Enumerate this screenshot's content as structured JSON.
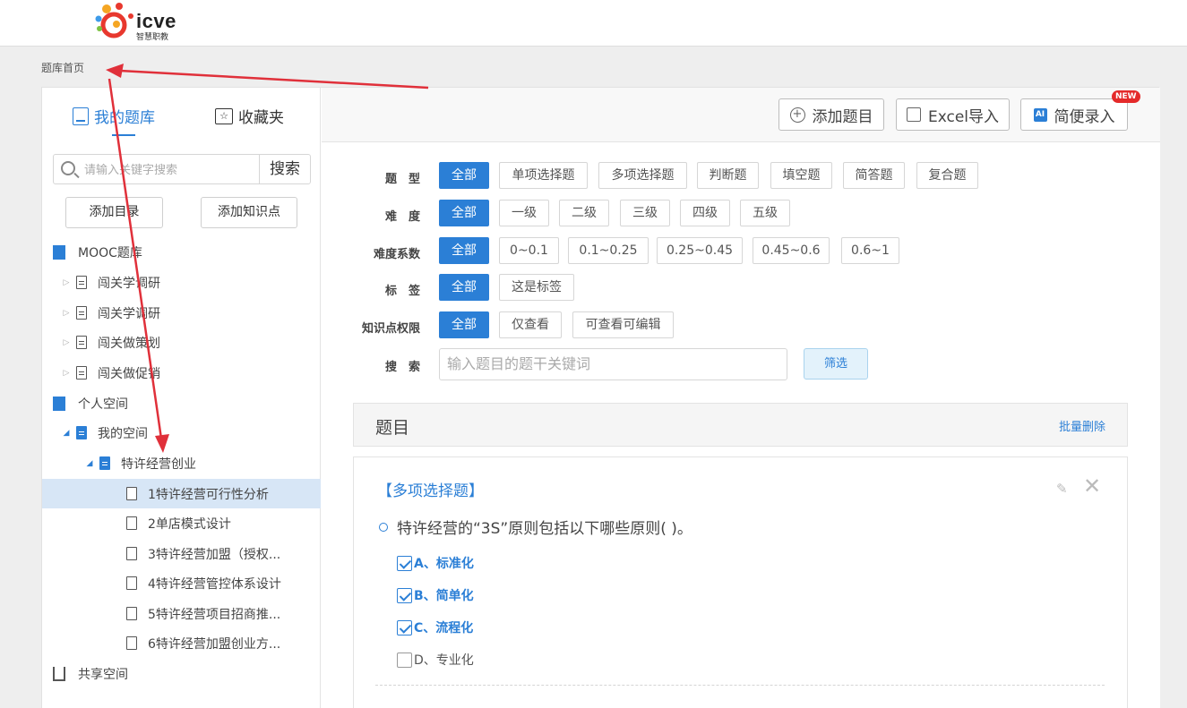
{
  "header": {
    "logo_text": "icve",
    "logo_subtitle": "智慧职教"
  },
  "breadcrumb": "题库首页",
  "sidebar": {
    "tabs": [
      {
        "label": "我的题库",
        "icon": "book-icon",
        "active": true
      },
      {
        "label": "收藏夹",
        "icon": "star-icon",
        "active": false
      }
    ],
    "search": {
      "placeholder": "请输入关键字搜索",
      "button": "搜索"
    },
    "buttons": {
      "add_dir": "添加目录",
      "add_kp": "添加知识点"
    },
    "tree": [
      {
        "label": "MOOC题库",
        "icon": "library-icon",
        "level": 0
      },
      {
        "label": "闯关学调研",
        "icon": "file-icon",
        "level": 1
      },
      {
        "label": "闯关学调研",
        "icon": "file-icon",
        "level": 1
      },
      {
        "label": "闯关做策划",
        "icon": "file-icon",
        "level": 1
      },
      {
        "label": "闯关做促销",
        "icon": "file-icon",
        "level": 1
      },
      {
        "label": "个人空间",
        "icon": "library-icon",
        "level": 0
      },
      {
        "label": "我的空间",
        "icon": "file-icon",
        "level": 1,
        "expanded": true
      },
      {
        "label": "特许经营创业",
        "icon": "file-icon",
        "level": 2,
        "expanded": true
      },
      {
        "label": "1特许经营可行性分析",
        "icon": "document-icon",
        "level": 3,
        "selected": true
      },
      {
        "label": "2单店模式设计",
        "icon": "document-icon",
        "level": 3
      },
      {
        "label": "3特许经营加盟（授权...",
        "icon": "document-icon",
        "level": 3
      },
      {
        "label": "4特许经营管控体系设计",
        "icon": "document-icon",
        "level": 3
      },
      {
        "label": "5特许经营项目招商推...",
        "icon": "document-icon",
        "level": 3
      },
      {
        "label": "6特许经营加盟创业方...",
        "icon": "document-icon",
        "level": 3
      },
      {
        "label": "共享空间",
        "icon": "library-outline-icon",
        "level": 0
      }
    ]
  },
  "toolbar": {
    "add_question": "添加题目",
    "excel_import": "Excel导入",
    "quick_entry": "简便录入",
    "new_badge": "NEW"
  },
  "filters": {
    "type": {
      "label": "题　型",
      "options": [
        "全部",
        "单项选择题",
        "多项选择题",
        "判断题",
        "填空题",
        "简答题",
        "复合题"
      ],
      "selected": "全部"
    },
    "difficulty": {
      "label": "难　度",
      "options": [
        "全部",
        "一级",
        "二级",
        "三级",
        "四级",
        "五级"
      ],
      "selected": "全部"
    },
    "coefficient": {
      "label": "难度系数",
      "options": [
        "全部",
        "0~0.1",
        "0.1~0.25",
        "0.25~0.45",
        "0.45~0.6",
        "0.6~1"
      ],
      "selected": "全部"
    },
    "tag": {
      "label": "标　签",
      "options": [
        "全部",
        "这是标签"
      ],
      "selected": "全部"
    },
    "permission": {
      "label": "知识点权限",
      "options": [
        "全部",
        "仅查看",
        "可查看可编辑"
      ],
      "selected": "全部"
    },
    "search": {
      "label": "搜　索",
      "placeholder": "输入题目的题干关键词",
      "button": "筛选"
    }
  },
  "question_list": {
    "title": "题目",
    "bulk_delete": "批量删除",
    "question": {
      "type": "【多项选择题】",
      "stem": "特许经营的“3S”原则包括以下哪些原则( )。",
      "options": [
        {
          "label": "A、标准化",
          "checked": true
        },
        {
          "label": "B、简单化",
          "checked": true
        },
        {
          "label": "C、流程化",
          "checked": true
        },
        {
          "label": "D、专业化",
          "checked": false
        }
      ]
    }
  },
  "colors": {
    "accent": "#2b7fd6",
    "annotation_arrow": "#e0303a",
    "selected_row": "#d7e6f6",
    "badge": "#e42a2a"
  }
}
